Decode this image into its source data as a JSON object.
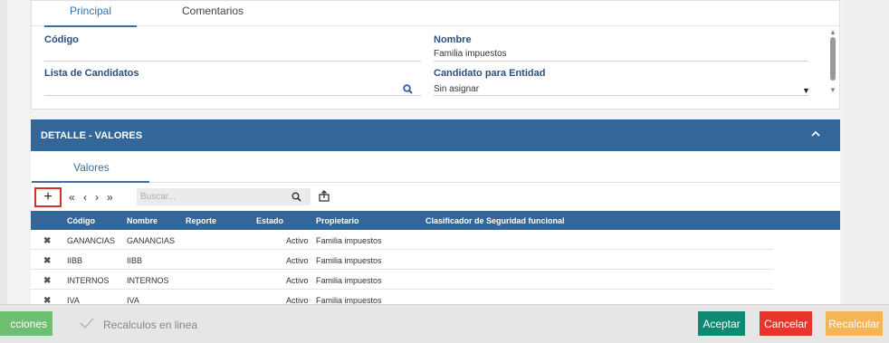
{
  "tabs": [
    {
      "label": "Principal"
    },
    {
      "label": "Comentarios"
    }
  ],
  "form": {
    "codigo_label": "Código",
    "codigo_value": "",
    "lista_label": "Lista de Candidatos",
    "lista_value": "",
    "nombre_label": "Nombre",
    "nombre_value": "Familia impuestos",
    "candidato_label": "Candidato para Entidad",
    "candidato_value": "Sin asignar"
  },
  "section": {
    "title": "DETALLE - VALORES",
    "subtab": "Valores"
  },
  "toolbar": {
    "add_label": "+",
    "first": "«",
    "prev": "‹",
    "next": "›",
    "last": "»",
    "search_placeholder": "Buscar..."
  },
  "grid": {
    "columns": [
      "Código",
      "Nombre",
      "Reporte",
      "Estado",
      "Propietario",
      "Clasificador de Seguridad funcional"
    ],
    "rows": [
      {
        "codigo": "GANANCIAS",
        "nombre": "GANANCIAS",
        "reporte": "",
        "estado": "Activo",
        "propietario": "Familia impuestos",
        "clasificador": ""
      },
      {
        "codigo": "IIBB",
        "nombre": "IIBB",
        "reporte": "",
        "estado": "Activo",
        "propietario": "Familia impuestos",
        "clasificador": ""
      },
      {
        "codigo": "INTERNOS",
        "nombre": "INTERNOS",
        "reporte": "",
        "estado": "Activo",
        "propietario": "Familia impuestos",
        "clasificador": ""
      },
      {
        "codigo": "IVA",
        "nombre": "IVA",
        "reporte": "",
        "estado": "Activo",
        "propietario": "Familia impuestos",
        "clasificador": ""
      }
    ]
  },
  "footer": {
    "acciones": "cciones",
    "recalculos": "Recalculos en linea",
    "aceptar": "Aceptar",
    "cancelar": "Cancelar",
    "recalcular": "Recalcular"
  },
  "colors": {
    "header_blue": "#336699",
    "label_blue": "#2c4f80",
    "accent_red": "#d3312b",
    "aceptar": "#0e8a73",
    "cancelar": "#e8352b",
    "recalcular": "#f4b557",
    "acciones": "#6fbf73"
  }
}
